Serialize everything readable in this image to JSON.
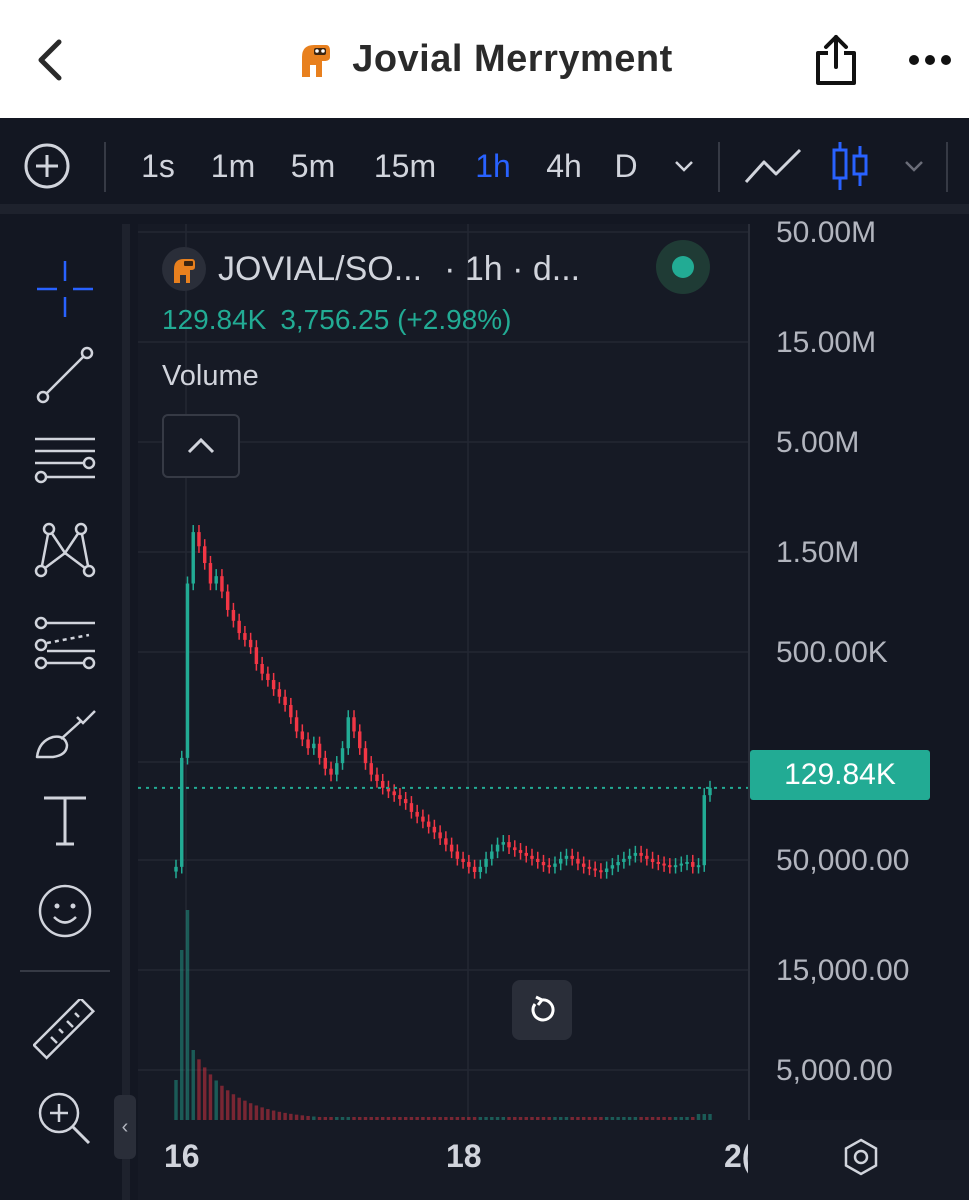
{
  "header": {
    "title": "Jovial Merryment"
  },
  "toolbar": {
    "intervals": [
      "1s",
      "1m",
      "5m",
      "15m",
      "1h",
      "4h",
      "D"
    ],
    "active_interval": "1h"
  },
  "legend": {
    "symbol": "JOVIAL/SO...",
    "interval": "· 1h · d...",
    "ohlc_value": "129.84K",
    "change": "3,756.25 (+2.98%)",
    "indicator": "Volume"
  },
  "price_scale": {
    "labels": [
      "50.00M",
      "15.00M",
      "5.00M",
      "1.50M",
      "500.00K",
      "50,000.00",
      "15,000.00",
      "5,000.00"
    ],
    "current_price": "129.84K"
  },
  "time_scale": {
    "labels": [
      "16",
      "18",
      "2("
    ]
  },
  "colors": {
    "up": "#22ab94",
    "down": "#f23645",
    "accent": "#2962ff",
    "background": "#131722"
  },
  "chart_data": {
    "type": "candlestick",
    "scale": "log",
    "ylim": [
      3500,
      60000000
    ],
    "xlabels": [
      "16",
      "18",
      "2("
    ],
    "last_price": 129840,
    "series": [
      {
        "name": "Volume",
        "type": "bar"
      }
    ],
    "close": [
      55000,
      180000,
      1200000,
      2100000,
      1800000,
      1500000,
      1200000,
      1300000,
      1100000,
      900000,
      800000,
      700000,
      650000,
      600000,
      500000,
      450000,
      420000,
      380000,
      350000,
      320000,
      280000,
      240000,
      220000,
      200000,
      210000,
      180000,
      160000,
      150000,
      170000,
      200000,
      280000,
      240000,
      200000,
      170000,
      150000,
      140000,
      130000,
      125000,
      120000,
      115000,
      110000,
      100000,
      95000,
      90000,
      85000,
      80000,
      75000,
      70000,
      65000,
      60000,
      58000,
      55000,
      52000,
      55000,
      60000,
      65000,
      70000,
      72000,
      68000,
      66000,
      64000,
      62000,
      60000,
      58000,
      56000,
      55000,
      57000,
      60000,
      62000,
      60000,
      57000,
      55000,
      54000,
      53000,
      52000,
      54000,
      56000,
      58000,
      60000,
      62000,
      64000,
      62000,
      60000,
      58000,
      57000,
      56000,
      55000,
      56000,
      57000,
      58000,
      55000,
      56000,
      120000,
      129840
    ]
  }
}
